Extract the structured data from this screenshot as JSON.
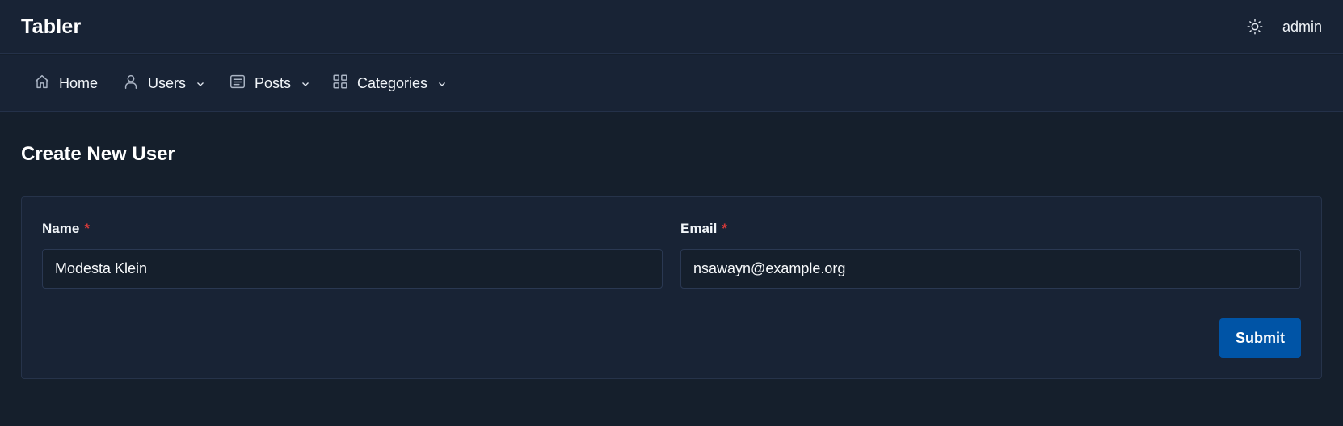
{
  "header": {
    "brand": "Tabler",
    "theme_icon": "sun-icon",
    "user": "admin"
  },
  "nav": {
    "items": [
      {
        "label": "Home",
        "icon": "home-icon",
        "dropdown": false
      },
      {
        "label": "Users",
        "icon": "user-icon",
        "dropdown": true
      },
      {
        "label": "Posts",
        "icon": "list-icon",
        "dropdown": true
      },
      {
        "label": "Categories",
        "icon": "grid-icon",
        "dropdown": true
      }
    ]
  },
  "page": {
    "title": "Create New User"
  },
  "form": {
    "name": {
      "label": "Name",
      "required_mark": "*",
      "value": "Modesta Klein"
    },
    "email": {
      "label": "Email",
      "required_mark": "*",
      "value": "nsawayn@example.org"
    },
    "submit_label": "Submit"
  },
  "colors": {
    "background": "#151f2c",
    "surface": "#182335",
    "primary": "#0054a6",
    "required": "#d63939"
  }
}
